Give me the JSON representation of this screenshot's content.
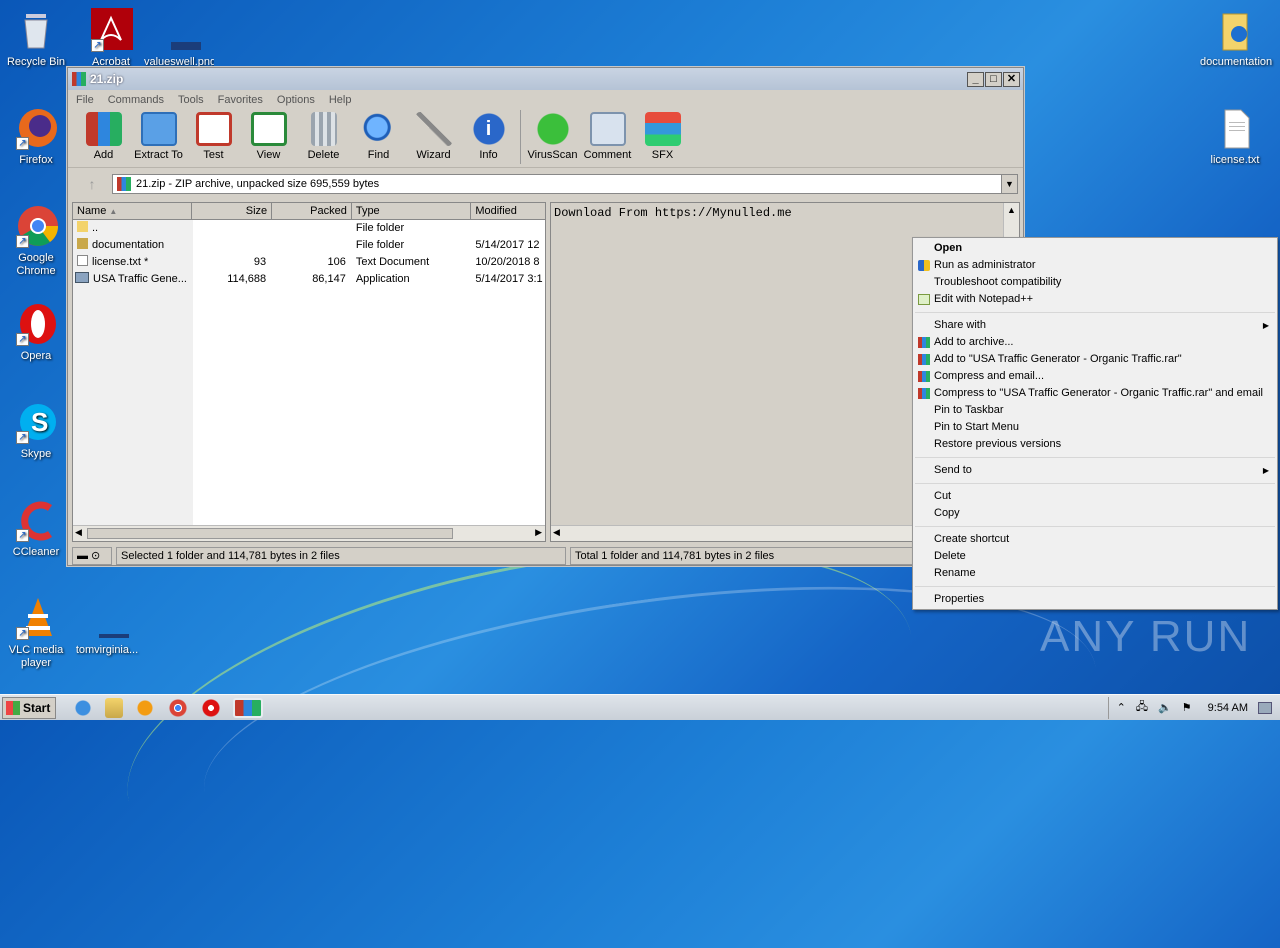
{
  "desktop": {
    "left_icons": [
      {
        "label": "Recycle Bin",
        "icon": "recycle-bin-icon"
      },
      {
        "label": "Acrobat",
        "icon": "acrobat-icon"
      },
      {
        "label": "valueswell.png",
        "icon": "image-file-icon"
      },
      {
        "label": "Firefox",
        "icon": "firefox-icon"
      },
      {
        "label": "Google Chrome",
        "icon": "chrome-icon"
      },
      {
        "label": "Opera",
        "icon": "opera-icon"
      },
      {
        "label": "Skype",
        "icon": "skype-icon"
      },
      {
        "label": "CCleaner",
        "icon": "ccleaner-icon"
      },
      {
        "label": "VLC media player",
        "icon": "vlc-icon"
      },
      {
        "label": "tomvirginia...",
        "icon": "file-icon"
      }
    ],
    "right_icons": [
      {
        "label": "documentation",
        "icon": "folder-icon"
      },
      {
        "label": "license.txt",
        "icon": "text-file-icon"
      }
    ],
    "watermark": "ANY RUN"
  },
  "window": {
    "title": "21.zip",
    "menu": [
      "File",
      "Commands",
      "Tools",
      "Favorites",
      "Options",
      "Help"
    ],
    "toolbar": [
      "Add",
      "Extract To",
      "Test",
      "View",
      "Delete",
      "Find",
      "Wizard",
      "Info",
      "VirusScan",
      "Comment",
      "SFX"
    ],
    "address": "21.zip - ZIP archive, unpacked size 695,559 bytes",
    "columns": [
      "Name",
      "Size",
      "Packed",
      "Type",
      "Modified"
    ],
    "rows": [
      {
        "name": "..",
        "size": "",
        "packed": "",
        "type": "File folder",
        "modified": ""
      },
      {
        "name": "documentation",
        "size": "",
        "packed": "",
        "type": "File folder",
        "modified": "5/14/2017 12"
      },
      {
        "name": "license.txt *",
        "size": "93",
        "packed": "106",
        "type": "Text Document",
        "modified": "10/20/2018 8"
      },
      {
        "name": "USA Traffic Gene...",
        "size": "114,688",
        "packed": "86,147",
        "type": "Application",
        "modified": "5/14/2017 3:1"
      }
    ],
    "preview_text": "Download From https://Mynulled.me",
    "status_left": "Selected 1 folder and 114,781 bytes in 2 files",
    "status_right": "Total 1 folder and 114,781 bytes in 2 files"
  },
  "context_menu": {
    "groups": [
      [
        {
          "label": "Open",
          "bold": true,
          "icon": ""
        },
        {
          "label": "Run as administrator",
          "icon": "shield-icon"
        },
        {
          "label": "Troubleshoot compatibility",
          "icon": ""
        },
        {
          "label": "Edit with Notepad++",
          "icon": "notepadpp-icon"
        }
      ],
      [
        {
          "label": "Share with",
          "icon": "",
          "submenu": true
        },
        {
          "label": "Add to archive...",
          "icon": "winrar-icon"
        },
        {
          "label": "Add to \"USA Traffic Generator - Organic Traffic.rar\"",
          "icon": "winrar-icon"
        },
        {
          "label": "Compress and email...",
          "icon": "winrar-icon"
        },
        {
          "label": "Compress to \"USA Traffic Generator - Organic Traffic.rar\" and email",
          "icon": "winrar-icon"
        },
        {
          "label": "Pin to Taskbar",
          "icon": ""
        },
        {
          "label": "Pin to Start Menu",
          "icon": ""
        },
        {
          "label": "Restore previous versions",
          "icon": ""
        }
      ],
      [
        {
          "label": "Send to",
          "icon": "",
          "submenu": true
        }
      ],
      [
        {
          "label": "Cut",
          "icon": ""
        },
        {
          "label": "Copy",
          "icon": ""
        }
      ],
      [
        {
          "label": "Create shortcut",
          "icon": ""
        },
        {
          "label": "Delete",
          "icon": ""
        },
        {
          "label": "Rename",
          "icon": ""
        }
      ],
      [
        {
          "label": "Properties",
          "icon": ""
        }
      ]
    ]
  },
  "taskbar": {
    "start_label": "Start",
    "pinned": [
      "ie-icon",
      "explorer-icon",
      "media-player-icon",
      "chrome-icon",
      "opera-icon",
      "winrar-icon"
    ],
    "clock": "9:54 AM"
  }
}
